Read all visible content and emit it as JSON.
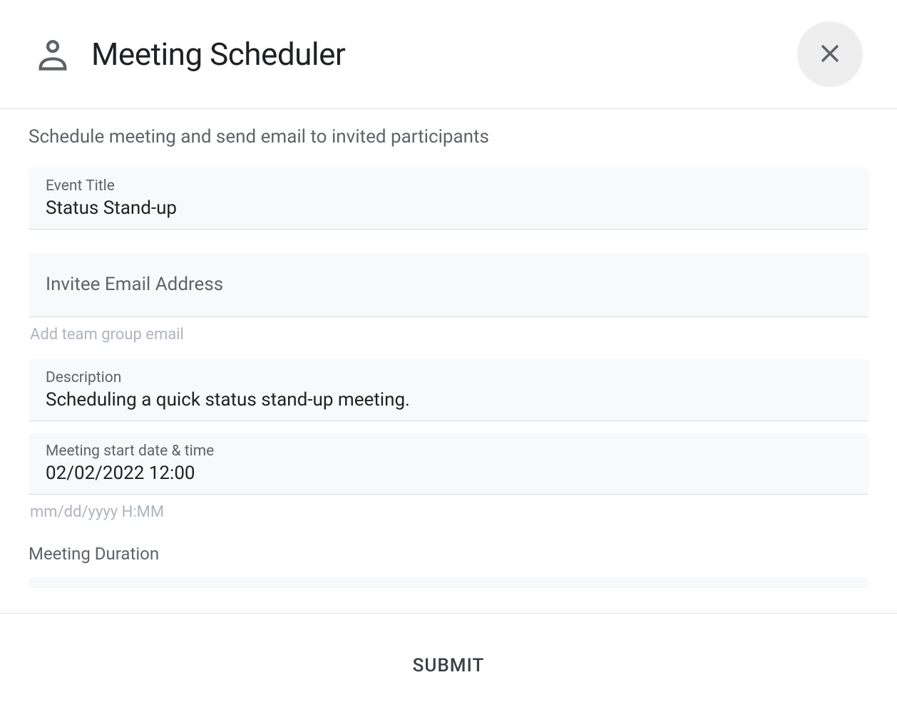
{
  "header": {
    "title": "Meeting Scheduler"
  },
  "form": {
    "subtitle": "Schedule meeting and send email to invited participants",
    "event_title": {
      "label": "Event Title",
      "value": "Status Stand-up"
    },
    "invitee_email": {
      "label": "Invitee Email Address",
      "value": "",
      "helper": "Add team group email"
    },
    "description": {
      "label": "Description",
      "value": "Scheduling a quick status stand-up meeting."
    },
    "start_datetime": {
      "label": "Meeting start date & time",
      "value": "02/02/2022 12:00",
      "helper": "mm/dd/yyyy H:MM"
    },
    "duration": {
      "label": "Meeting Duration"
    }
  },
  "footer": {
    "submit_label": "SUBMIT"
  }
}
